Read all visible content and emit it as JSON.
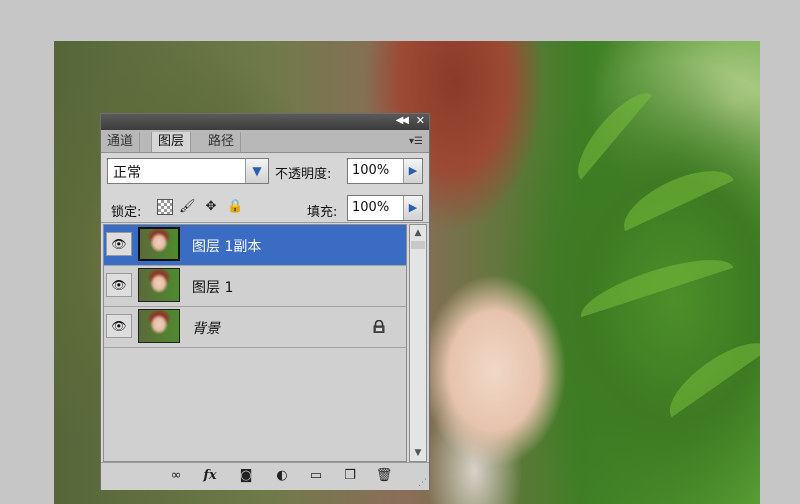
{
  "panel": {
    "tabs": [
      {
        "label": "通道"
      },
      {
        "label": "图层"
      },
      {
        "label": "路径"
      }
    ],
    "blend_mode": "正常",
    "opacity_label": "不透明度:",
    "opacity_value": "100%",
    "lock_label": "锁定:",
    "fill_label": "填充:",
    "fill_value": "100%",
    "layers": [
      {
        "name": "图层 1副本",
        "selected": true
      },
      {
        "name": "图层 1",
        "selected": false
      },
      {
        "name": "背景",
        "selected": false,
        "locked": true
      }
    ]
  },
  "icons": {
    "collapse": "double-chevron-left-icon",
    "close": "close-icon",
    "panel_menu": "panel-menu-icon",
    "eye": "eye-icon",
    "lock": "lock-icon"
  },
  "colors": {
    "selected_row": "#3a6cc4",
    "panel_bg": "#d6d6d6",
    "title_bar": "#4a4a4a",
    "workspace": "#c6c6c6"
  }
}
